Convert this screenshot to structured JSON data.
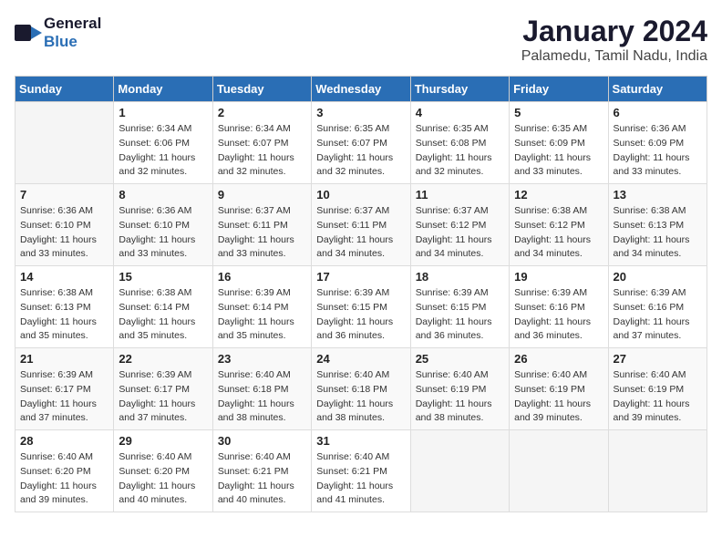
{
  "logo": {
    "general": "General",
    "blue": "Blue"
  },
  "title": "January 2024",
  "subtitle": "Palamedu, Tamil Nadu, India",
  "days_header": [
    "Sunday",
    "Monday",
    "Tuesday",
    "Wednesday",
    "Thursday",
    "Friday",
    "Saturday"
  ],
  "weeks": [
    [
      {
        "day": "",
        "content": ""
      },
      {
        "day": "1",
        "content": "Sunrise: 6:34 AM\nSunset: 6:06 PM\nDaylight: 11 hours\nand 32 minutes."
      },
      {
        "day": "2",
        "content": "Sunrise: 6:34 AM\nSunset: 6:07 PM\nDaylight: 11 hours\nand 32 minutes."
      },
      {
        "day": "3",
        "content": "Sunrise: 6:35 AM\nSunset: 6:07 PM\nDaylight: 11 hours\nand 32 minutes."
      },
      {
        "day": "4",
        "content": "Sunrise: 6:35 AM\nSunset: 6:08 PM\nDaylight: 11 hours\nand 32 minutes."
      },
      {
        "day": "5",
        "content": "Sunrise: 6:35 AM\nSunset: 6:09 PM\nDaylight: 11 hours\nand 33 minutes."
      },
      {
        "day": "6",
        "content": "Sunrise: 6:36 AM\nSunset: 6:09 PM\nDaylight: 11 hours\nand 33 minutes."
      }
    ],
    [
      {
        "day": "7",
        "content": "Sunrise: 6:36 AM\nSunset: 6:10 PM\nDaylight: 11 hours\nand 33 minutes."
      },
      {
        "day": "8",
        "content": "Sunrise: 6:36 AM\nSunset: 6:10 PM\nDaylight: 11 hours\nand 33 minutes."
      },
      {
        "day": "9",
        "content": "Sunrise: 6:37 AM\nSunset: 6:11 PM\nDaylight: 11 hours\nand 33 minutes."
      },
      {
        "day": "10",
        "content": "Sunrise: 6:37 AM\nSunset: 6:11 PM\nDaylight: 11 hours\nand 34 minutes."
      },
      {
        "day": "11",
        "content": "Sunrise: 6:37 AM\nSunset: 6:12 PM\nDaylight: 11 hours\nand 34 minutes."
      },
      {
        "day": "12",
        "content": "Sunrise: 6:38 AM\nSunset: 6:12 PM\nDaylight: 11 hours\nand 34 minutes."
      },
      {
        "day": "13",
        "content": "Sunrise: 6:38 AM\nSunset: 6:13 PM\nDaylight: 11 hours\nand 34 minutes."
      }
    ],
    [
      {
        "day": "14",
        "content": "Sunrise: 6:38 AM\nSunset: 6:13 PM\nDaylight: 11 hours\nand 35 minutes."
      },
      {
        "day": "15",
        "content": "Sunrise: 6:38 AM\nSunset: 6:14 PM\nDaylight: 11 hours\nand 35 minutes."
      },
      {
        "day": "16",
        "content": "Sunrise: 6:39 AM\nSunset: 6:14 PM\nDaylight: 11 hours\nand 35 minutes."
      },
      {
        "day": "17",
        "content": "Sunrise: 6:39 AM\nSunset: 6:15 PM\nDaylight: 11 hours\nand 36 minutes."
      },
      {
        "day": "18",
        "content": "Sunrise: 6:39 AM\nSunset: 6:15 PM\nDaylight: 11 hours\nand 36 minutes."
      },
      {
        "day": "19",
        "content": "Sunrise: 6:39 AM\nSunset: 6:16 PM\nDaylight: 11 hours\nand 36 minutes."
      },
      {
        "day": "20",
        "content": "Sunrise: 6:39 AM\nSunset: 6:16 PM\nDaylight: 11 hours\nand 37 minutes."
      }
    ],
    [
      {
        "day": "21",
        "content": "Sunrise: 6:39 AM\nSunset: 6:17 PM\nDaylight: 11 hours\nand 37 minutes."
      },
      {
        "day": "22",
        "content": "Sunrise: 6:39 AM\nSunset: 6:17 PM\nDaylight: 11 hours\nand 37 minutes."
      },
      {
        "day": "23",
        "content": "Sunrise: 6:40 AM\nSunset: 6:18 PM\nDaylight: 11 hours\nand 38 minutes."
      },
      {
        "day": "24",
        "content": "Sunrise: 6:40 AM\nSunset: 6:18 PM\nDaylight: 11 hours\nand 38 minutes."
      },
      {
        "day": "25",
        "content": "Sunrise: 6:40 AM\nSunset: 6:19 PM\nDaylight: 11 hours\nand 38 minutes."
      },
      {
        "day": "26",
        "content": "Sunrise: 6:40 AM\nSunset: 6:19 PM\nDaylight: 11 hours\nand 39 minutes."
      },
      {
        "day": "27",
        "content": "Sunrise: 6:40 AM\nSunset: 6:19 PM\nDaylight: 11 hours\nand 39 minutes."
      }
    ],
    [
      {
        "day": "28",
        "content": "Sunrise: 6:40 AM\nSunset: 6:20 PM\nDaylight: 11 hours\nand 39 minutes."
      },
      {
        "day": "29",
        "content": "Sunrise: 6:40 AM\nSunset: 6:20 PM\nDaylight: 11 hours\nand 40 minutes."
      },
      {
        "day": "30",
        "content": "Sunrise: 6:40 AM\nSunset: 6:21 PM\nDaylight: 11 hours\nand 40 minutes."
      },
      {
        "day": "31",
        "content": "Sunrise: 6:40 AM\nSunset: 6:21 PM\nDaylight: 11 hours\nand 41 minutes."
      },
      {
        "day": "",
        "content": ""
      },
      {
        "day": "",
        "content": ""
      },
      {
        "day": "",
        "content": ""
      }
    ]
  ]
}
